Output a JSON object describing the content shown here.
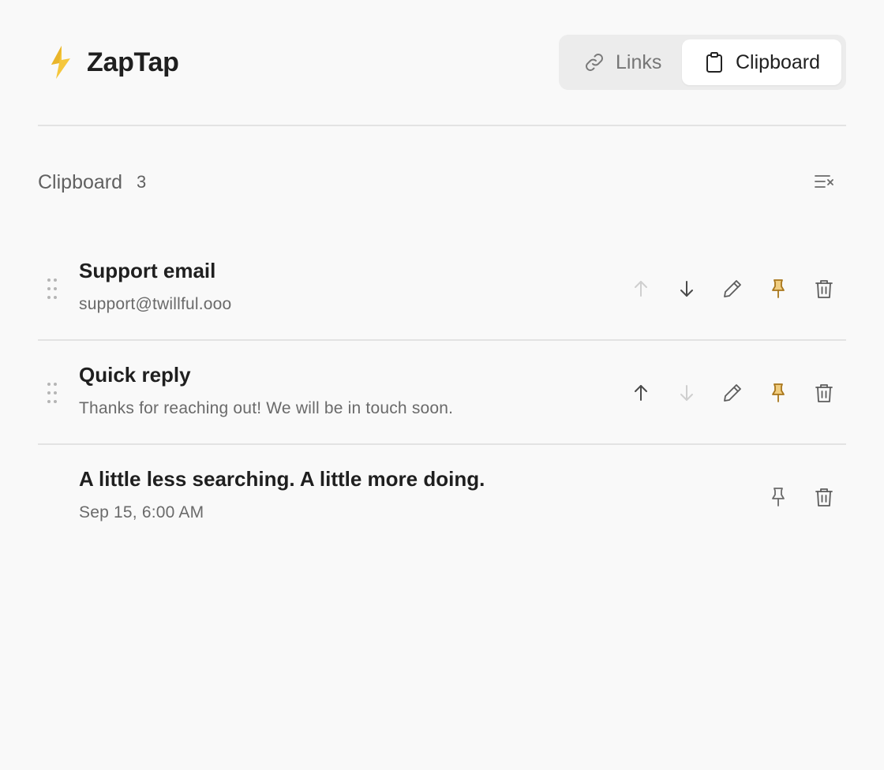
{
  "app": {
    "name": "ZapTap"
  },
  "tabs": [
    {
      "label": "Links",
      "icon": "link-icon",
      "active": false
    },
    {
      "label": "Clipboard",
      "icon": "clipboard-icon",
      "active": true
    }
  ],
  "section": {
    "title": "Clipboard",
    "count": "3",
    "clear_icon": "clear-list-icon"
  },
  "colors": {
    "accent_pin": "#a8761b",
    "logo": "#f5c73d",
    "muted": "#c4c4c4",
    "icon": "#5c5c5c"
  },
  "items": [
    {
      "title": "Support email",
      "subtitle": "support@twillful.ooo",
      "pinned": true,
      "up_enabled": false,
      "down_enabled": true
    },
    {
      "title": "Quick reply",
      "subtitle": "Thanks for reaching out! We will be in touch soon.",
      "pinned": true,
      "up_enabled": true,
      "down_enabled": false
    },
    {
      "title": "A little less searching. A little more doing.",
      "subtitle": "Sep 15, 6:00 AM",
      "pinned": false
    }
  ]
}
